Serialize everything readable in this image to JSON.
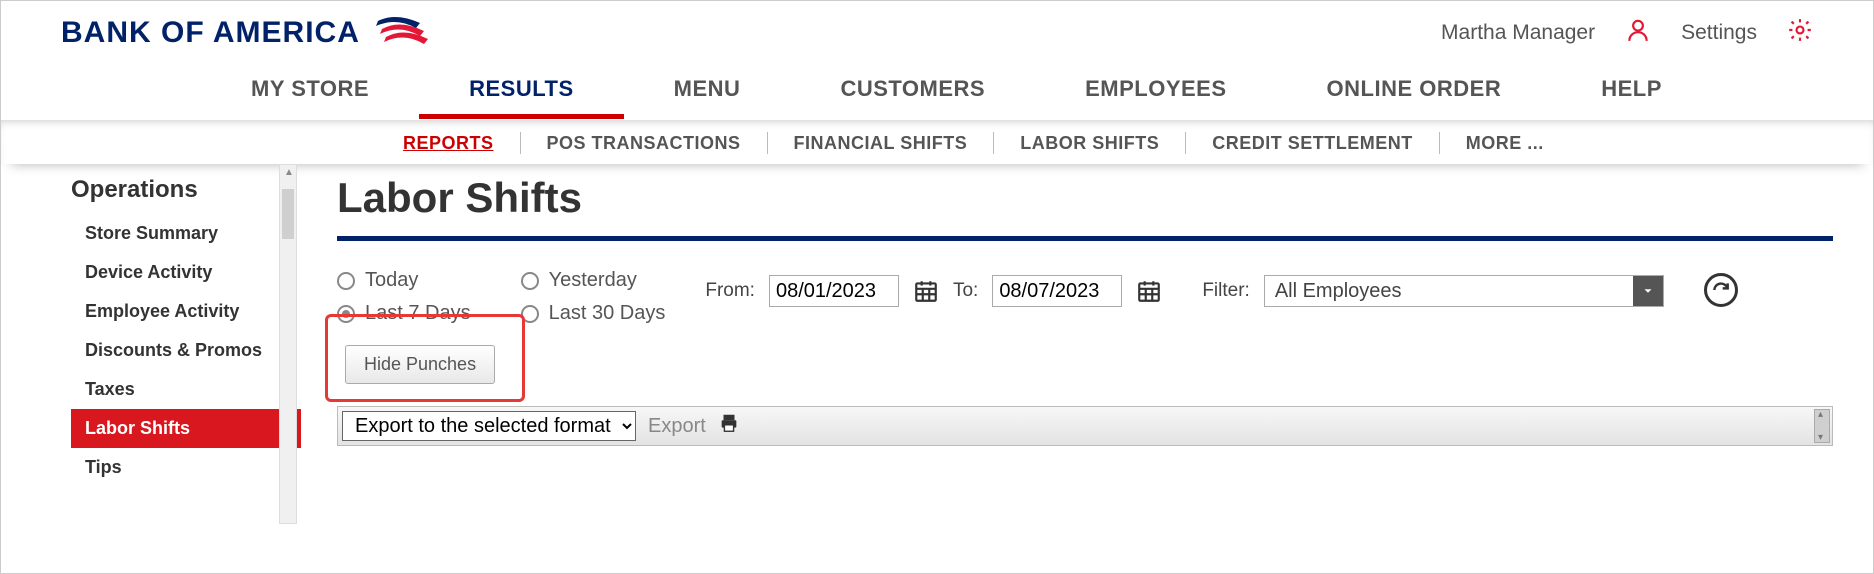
{
  "brand": {
    "name": "BANK OF AMERICA"
  },
  "header": {
    "user_name": "Martha Manager",
    "settings_label": "Settings"
  },
  "main_nav": {
    "items": [
      {
        "label": "MY STORE"
      },
      {
        "label": "RESULTS",
        "active": true
      },
      {
        "label": "MENU"
      },
      {
        "label": "CUSTOMERS"
      },
      {
        "label": "EMPLOYEES"
      },
      {
        "label": "ONLINE ORDER"
      },
      {
        "label": "HELP"
      }
    ]
  },
  "sub_nav": {
    "items": [
      {
        "label": "REPORTS",
        "active": true
      },
      {
        "label": "POS TRANSACTIONS"
      },
      {
        "label": "FINANCIAL SHIFTS"
      },
      {
        "label": "LABOR SHIFTS"
      },
      {
        "label": "CREDIT SETTLEMENT"
      },
      {
        "label": "MORE ..."
      }
    ]
  },
  "sidebar": {
    "title": "Operations",
    "items": [
      {
        "label": "Store Summary"
      },
      {
        "label": "Device Activity"
      },
      {
        "label": "Employee Activity"
      },
      {
        "label": "Discounts & Promos"
      },
      {
        "label": "Taxes"
      },
      {
        "label": "Labor Shifts",
        "active": true
      },
      {
        "label": "Tips"
      }
    ]
  },
  "page": {
    "title": "Labor Shifts"
  },
  "radios": {
    "today": "Today",
    "yesterday": "Yesterday",
    "last7": "Last 7 Days",
    "last30": "Last 30 Days",
    "selected": "last7"
  },
  "dates": {
    "from_label": "From:",
    "to_label": "To:",
    "from_value": "08/01/2023",
    "to_value": "08/07/2023"
  },
  "filter": {
    "label": "Filter:",
    "selected": "All Employees"
  },
  "buttons": {
    "hide_punches": "Hide Punches"
  },
  "export": {
    "select_label": "Export to the selected format",
    "export_label": "Export"
  }
}
